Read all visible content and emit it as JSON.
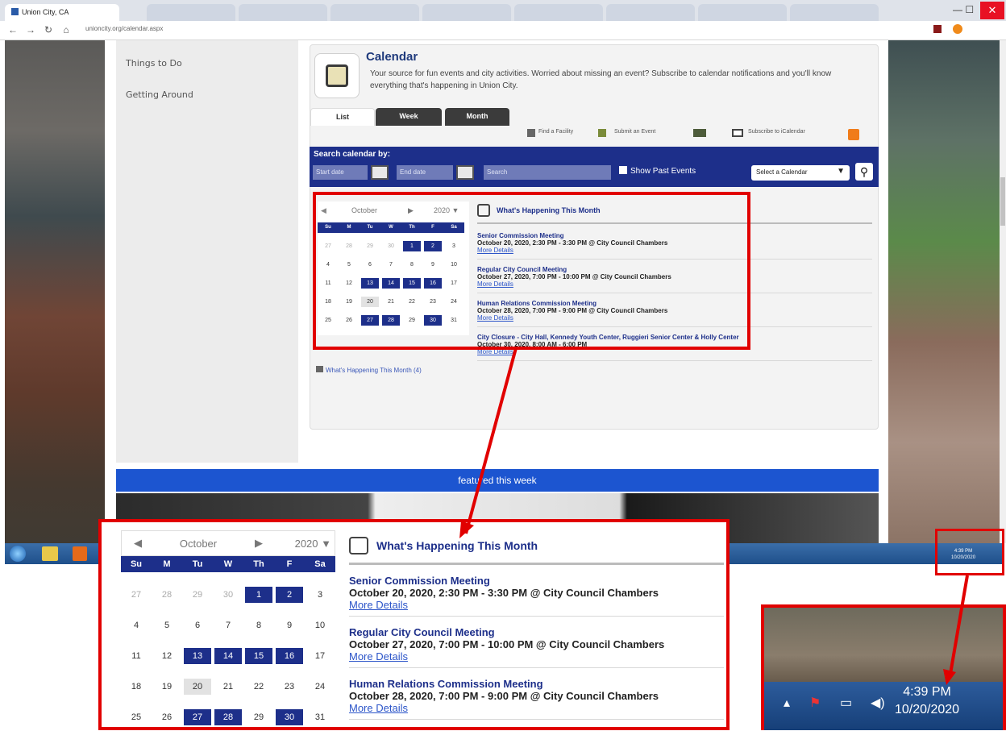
{
  "browser": {
    "tabs": [
      "Union City, CA",
      "",
      "",
      "",
      "",
      "",
      "",
      "",
      "",
      "",
      ""
    ],
    "url": "unioncity.org/calendar.aspx"
  },
  "sidebar": {
    "items": [
      "Things to Do",
      "Getting Around"
    ]
  },
  "calendar": {
    "title": "Calendar",
    "description": "Your source for fun events and city activities. Worried about missing an event? Subscribe to calendar notifications and you'll know everything that's happening in Union City.",
    "view_tabs": [
      "List",
      "Week",
      "Month"
    ],
    "tools": [
      "Find a Facility",
      "Submit an Event",
      "Subscribe to iCalendar"
    ],
    "search_label": "Search calendar by:",
    "start_placeholder": "Start date",
    "end_placeholder": "End date",
    "search_placeholder": "Search",
    "show_past": "Show Past Events",
    "select_calendar": "Select a Calendar"
  },
  "minical": {
    "month": "October",
    "year": "2020",
    "dow": [
      "Su",
      "M",
      "Tu",
      "W",
      "Th",
      "F",
      "Sa"
    ],
    "weeks": [
      [
        "27",
        "28",
        "29",
        "30",
        "1",
        "2",
        "3"
      ],
      [
        "4",
        "5",
        "6",
        "7",
        "8",
        "9",
        "10"
      ],
      [
        "11",
        "12",
        "13",
        "14",
        "15",
        "16",
        "17"
      ],
      [
        "18",
        "19",
        "20",
        "21",
        "22",
        "23",
        "24"
      ],
      [
        "25",
        "26",
        "27",
        "28",
        "29",
        "30",
        "31"
      ]
    ],
    "event_days": [
      "1",
      "2",
      "13",
      "14",
      "15",
      "16",
      "27",
      "28",
      "30"
    ],
    "today": "20"
  },
  "happening": {
    "title": "What's Happening This Month",
    "sidebar_link": "What's Happening This Month (4)",
    "events": [
      {
        "title": "Senior Commission Meeting",
        "date": "October 20, 2020, 2:30 PM - 3:30 PM @ City Council Chambers",
        "more": "More Details"
      },
      {
        "title": "Regular City Council Meeting",
        "date": "October 27, 2020, 7:00 PM - 10:00 PM @ City Council Chambers",
        "more": "More Details"
      },
      {
        "title": "Human Relations Commission Meeting",
        "date": "October 28, 2020, 7:00 PM - 9:00 PM @ City Council Chambers",
        "more": "More Details"
      },
      {
        "title": "City Closure - City Hall, Kennedy Youth Center, Ruggieri Senior Center & Holly Center",
        "date": "October 30, 2020, 8:00 AM - 6:00 PM",
        "more": "More Details"
      }
    ]
  },
  "featured": {
    "label": "featured this week"
  },
  "tray": {
    "time": "4:39 PM",
    "date": "10/20/2020"
  },
  "colors": {
    "highlight": "#e10000",
    "navy": "#1d2f8a",
    "featured": "#1c55d0"
  }
}
